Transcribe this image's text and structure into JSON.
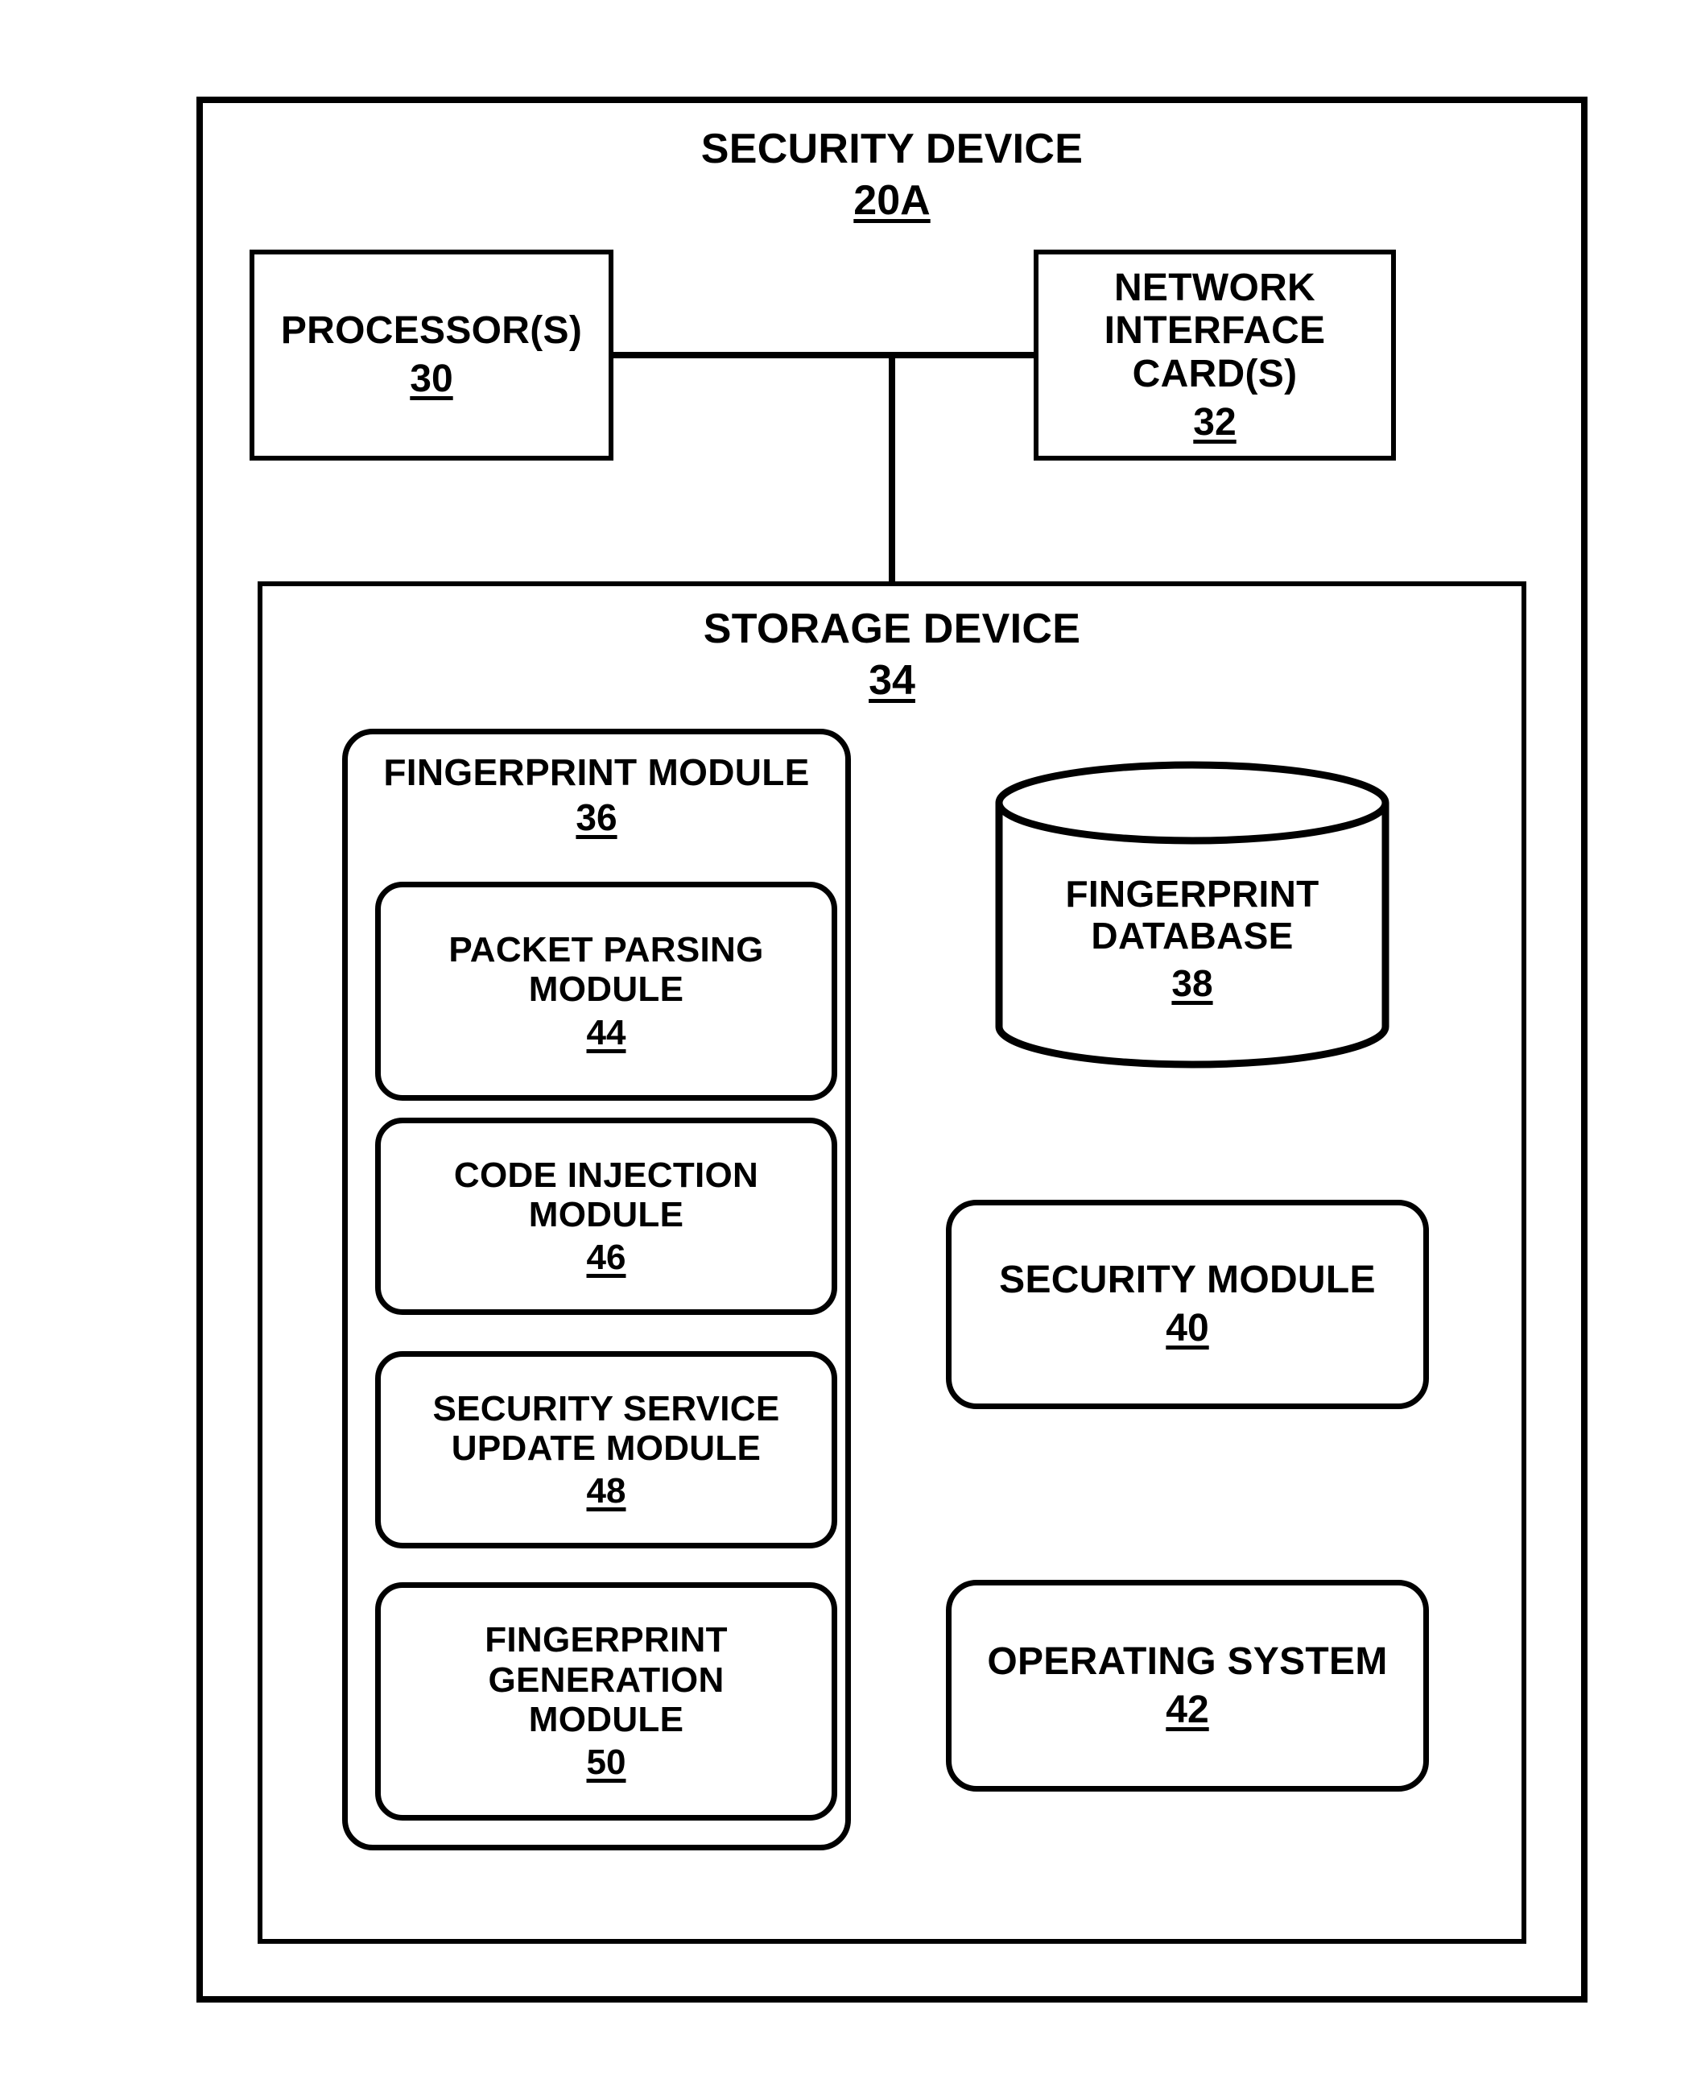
{
  "diagram": {
    "type": "block-diagram",
    "title": "SECURITY DEVICE",
    "accent_color": "#000000",
    "background_color": "#ffffff"
  },
  "security_device": {
    "label": "SECURITY DEVICE",
    "ref": "20A"
  },
  "processor": {
    "label": "PROCESSOR(S)",
    "ref": "30"
  },
  "network_interface_card": {
    "label": "NETWORK INTERFACE\nCARD(S)",
    "ref": "32"
  },
  "storage_device": {
    "label": "STORAGE DEVICE",
    "ref": "34"
  },
  "fingerprint_module": {
    "label": "FINGERPRINT MODULE",
    "ref": "36",
    "submodules": [
      {
        "label": "PACKET PARSING\nMODULE",
        "ref": "44"
      },
      {
        "label": "CODE INJECTION\nMODULE",
        "ref": "46"
      },
      {
        "label": "SECURITY SERVICE\nUPDATE MODULE",
        "ref": "48"
      },
      {
        "label": "FINGERPRINT\nGENERATION\nMODULE",
        "ref": "50"
      }
    ]
  },
  "fingerprint_database": {
    "label": "FINGERPRINT\nDATABASE",
    "ref": "38"
  },
  "security_module": {
    "label": "SECURITY MODULE",
    "ref": "40"
  },
  "operating_system": {
    "label": "OPERATING SYSTEM",
    "ref": "42"
  }
}
